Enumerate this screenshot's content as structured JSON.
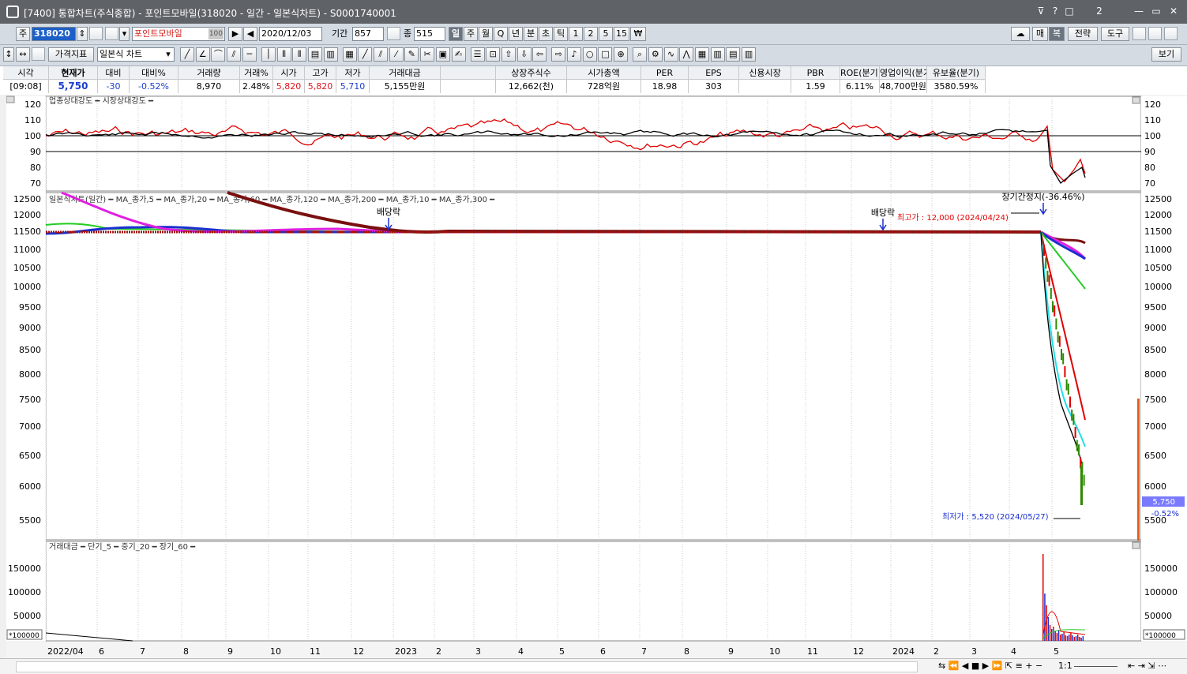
{
  "window": {
    "title": "[7400]   통합차트(주식종합) - 포인트모바일(318020 - 일간 - 일본식차트) - S0001740001",
    "controls": [
      "?",
      "□",
      "2",
      "—",
      "▭",
      "✕"
    ]
  },
  "toolbar1": {
    "market_label": "주",
    "code": "318020",
    "stock_name": "포인트모바일",
    "name_badge": "100",
    "date": "2020/12/03",
    "period_label": "기간",
    "period_value": "857",
    "count_label": "종",
    "count_value": "515",
    "intervals": [
      "일",
      "주",
      "월",
      "Q",
      "년",
      "분",
      "초",
      "틱",
      "1",
      "2",
      "5",
      "15",
      "₩"
    ],
    "right_buttons": [
      "매",
      "복",
      "전략",
      "도구"
    ]
  },
  "toolbar2": {
    "indicator_label": "가격지표",
    "chart_type": "일본식 차트",
    "view_button": "보기"
  },
  "quote": {
    "headers": [
      "시각",
      "현재가",
      "대비",
      "대비%",
      "거래량",
      "거래%",
      "시가",
      "고가",
      "저가",
      "거래대금",
      "",
      "상장주식수",
      "시가총액",
      "PER",
      "EPS",
      "신용시장",
      "PBR",
      "ROE(분기)",
      "영업이익(분기)",
      "유보율(분기)"
    ],
    "values": [
      "[09:08]",
      "5,750",
      "-30",
      "-0.52%",
      "8,970",
      "2.48%",
      "5,820",
      "5,820",
      "5,710",
      "5,155만원",
      "",
      "12,662(천)",
      "728억원",
      "18.98",
      "303",
      "",
      "1.59",
      "6.11%",
      "48,700만원",
      "3580.59%"
    ]
  },
  "chart": {
    "strength_legend": "업종상대강도 ━ 시장상대강도 ━",
    "strength_ticks": [
      "120",
      "110",
      "100",
      "90",
      "80",
      "70"
    ],
    "price_legend": "일본식차트(일간) ━ MA_종가,5 ━ MA_종가,20 ━ MA_종가,60 ━ MA_종가,120 ━ MA_종가,200 ━ MA_종가,10 ━ MA_종가,300 ━",
    "price_ticks": [
      "12500",
      "12000",
      "11500",
      "11000",
      "10500",
      "10000",
      "9500",
      "9000",
      "8500",
      "8000",
      "7500",
      "7000",
      "6500",
      "6000",
      "5500"
    ],
    "dividend_label": "배당락",
    "dividend_label2": "배당락",
    "suspension_label": "장기간정지(-36.46%)",
    "high_label": "최고가 : 12,000 (2024/04/24)",
    "low_label": "최저가 : 5,520 (2024/05/27)",
    "current_price_tag": "5,750",
    "current_change_tag": "-0.52%",
    "volume_legend": "거래대금 ━ 단기_5 ━ 중기_20 ━ 장기_60 ━",
    "volume_ticks": [
      "150000",
      "100000",
      "50000"
    ],
    "volume_unit": "*100000",
    "x_labels": [
      "2022/04",
      "6",
      "7",
      "8",
      "9",
      "10",
      "11",
      "12",
      "2023",
      "2",
      "3",
      "4",
      "5",
      "6",
      "7",
      "8",
      "9",
      "10",
      "11",
      "12",
      "2024",
      "2",
      "3",
      "4",
      "5"
    ],
    "colors": {
      "ma5": "#ff8c00",
      "ma20": "#000000",
      "ma60": "#e00000",
      "ma120": "#22cc22",
      "ma200": "#1a2fd0",
      "ma10": "#e020e0",
      "ma300": "#7a1010",
      "ma_cyan": "#22e0e8"
    }
  },
  "statusbar": {
    "zoom": "1:1"
  }
}
